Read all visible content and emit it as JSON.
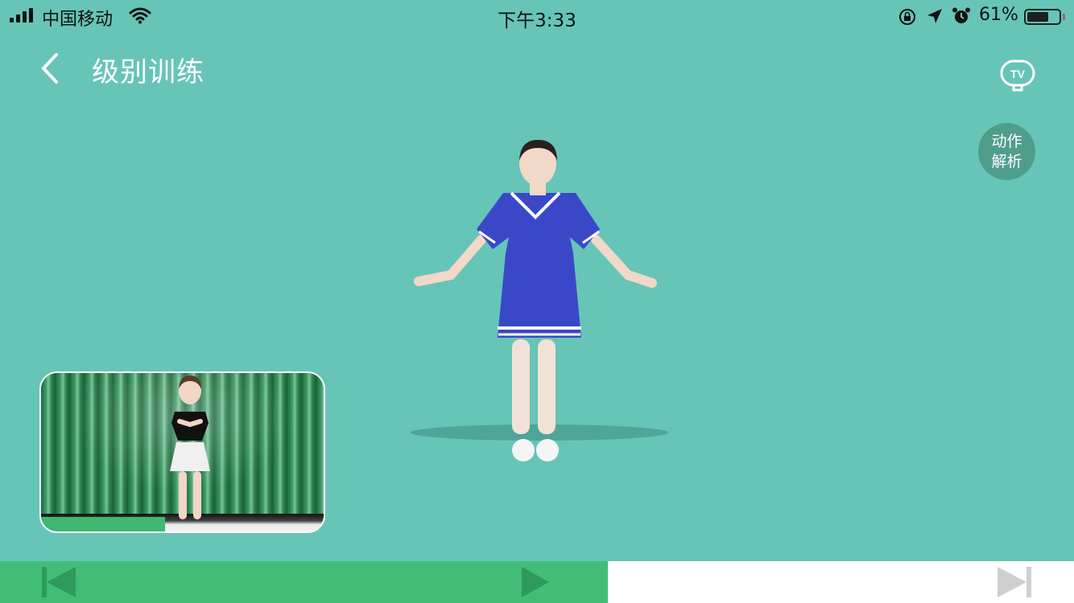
{
  "status_bar": {
    "carrier": "中国移动",
    "time": "下午3:33",
    "battery_percent": "61%",
    "battery_level": 0.61
  },
  "nav": {
    "title": "级别训练",
    "tv_label": "TV"
  },
  "analysis_button": {
    "line1": "动作",
    "line2": "解析"
  },
  "pip": {
    "progress": 0.44
  },
  "playback": {
    "progress": 0.566
  },
  "colors": {
    "background": "#66c5b7",
    "accent_green": "#41bd76",
    "analysis_bg": "#4f9e8c"
  },
  "icons": [
    "signal-icon",
    "wifi-icon",
    "orientation-lock-icon",
    "location-icon",
    "alarm-icon",
    "battery-icon",
    "back-chevron-icon",
    "tv-icon",
    "previous-icon",
    "play-icon",
    "next-icon"
  ]
}
